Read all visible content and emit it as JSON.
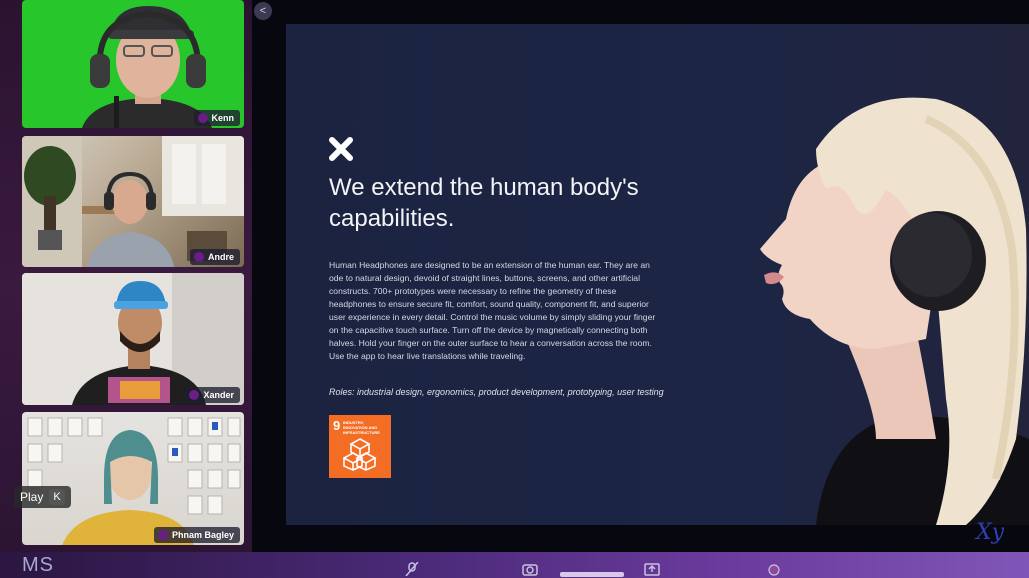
{
  "participants": [
    {
      "name": "Kenn"
    },
    {
      "name": "Andre"
    },
    {
      "name": "Xander"
    },
    {
      "name": "Phnam Bagley"
    }
  ],
  "controls": {
    "play_label": "Play",
    "play_shortcut": "K",
    "collapse_glyph": "<"
  },
  "slide": {
    "title": "We extend the human body's capabilities.",
    "body": "Human Headphones are designed to be an extension of the human ear. They are an ode to natural design, devoid of straight lines, buttons, screens, and other artificial constructs. 700+ prototypes were necessary to refine the geometry of these headphones to ensure secure fit, comfort, sound quality, component fit, and superior user experience in every detail. Control the music volume by simply sliding your finger on the capacitive touch surface. Turn off the device by magnetically connecting both halves. Hold your finger on the outer surface to hear a conversation across the room. Use the app to hear live translations while traveling.",
    "roles": "Roles: industrial design, ergonomics, product development, prototyping, user testing",
    "sdg_number": "9",
    "sdg_label": "INDUSTRY, INNOVATION AND INFRASTRUCTURE"
  },
  "branding": {
    "corner_logo": "Xy",
    "bottom_left_text": "MS"
  },
  "icons": [
    "x-mark-icon",
    "cube-stack-icon",
    "mic-off-icon",
    "camera-icon",
    "share-screen-icon",
    "record-icon"
  ],
  "colors": {
    "green_screen": "#27c62a",
    "slide_bg": "#1c2545",
    "sdg_orange": "#f36d25",
    "sidebar_bg": "#2b1330"
  }
}
